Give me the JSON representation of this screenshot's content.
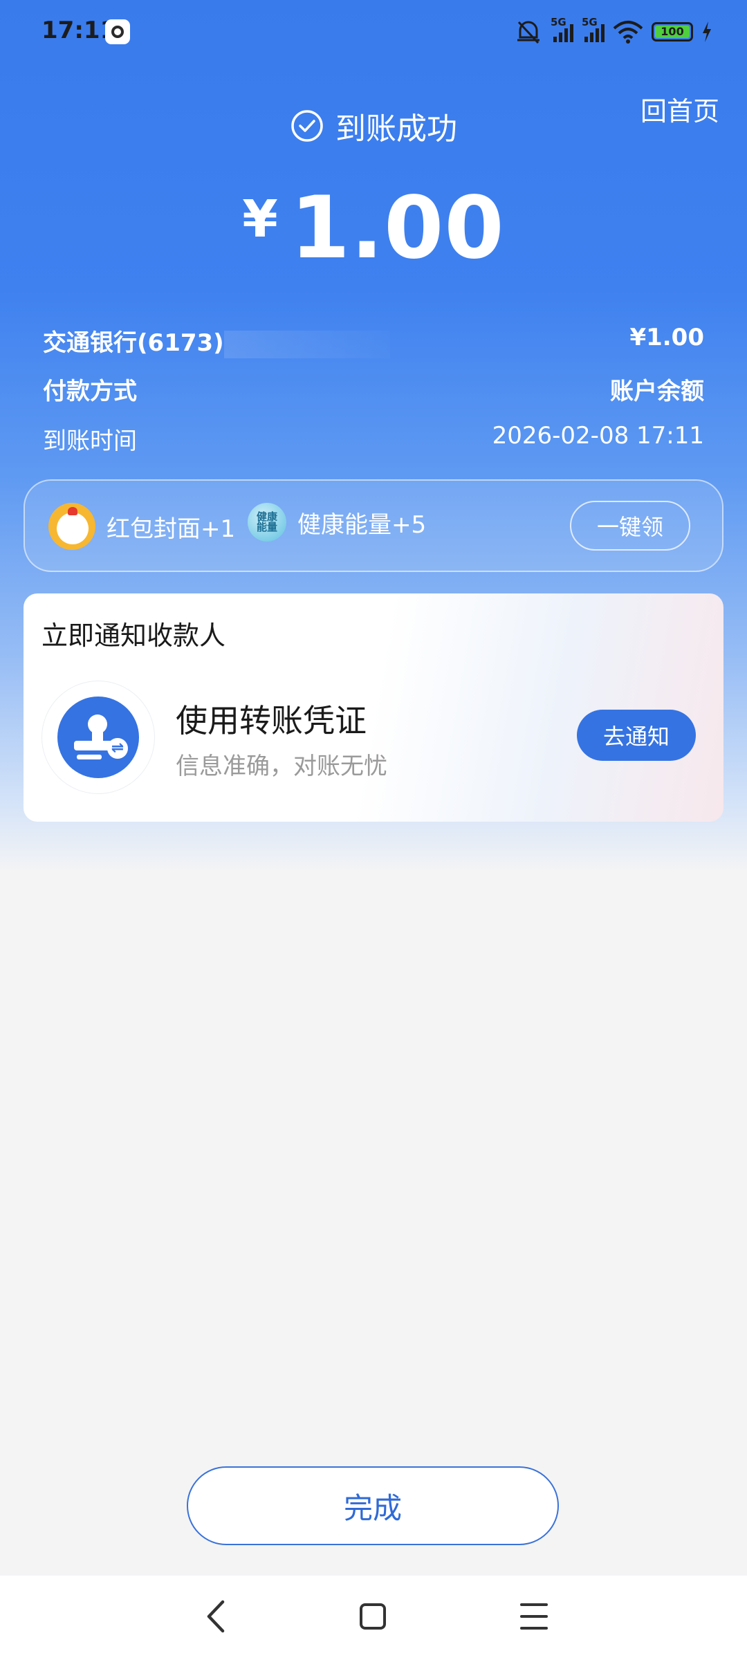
{
  "status_bar": {
    "time": "17:11",
    "network_1": "5G",
    "network_2": "5G",
    "battery": "100",
    "icons": [
      "app-notification-icon",
      "mute-icon",
      "signal-icon",
      "signal-icon",
      "wifi-icon",
      "battery-icon",
      "charging-icon"
    ]
  },
  "header": {
    "home_link": "回首页",
    "status_text": "到账成功",
    "currency": "¥",
    "amount": "1.00"
  },
  "details": {
    "bank_account": "交通银行(6173)",
    "bank_amount": "¥1.00",
    "payment_method_label": "付款方式",
    "payment_method_value": "账户余额",
    "arrival_time_label": "到账时间",
    "arrival_time_value": "2026-02-08 17:11"
  },
  "rewards": {
    "items": [
      {
        "label": "红包封面+1",
        "icon": "chick-avatar-icon"
      },
      {
        "label": "健康能量+5",
        "icon": "health-energy-icon",
        "icon_text": "健康能量"
      }
    ],
    "claim_button": "一键领"
  },
  "notify": {
    "title": "立即通知收款人",
    "main_text": "使用转账凭证",
    "sub_text": "信息准确，对账无忧",
    "button": "去通知"
  },
  "footer": {
    "done_button": "完成"
  },
  "colors": {
    "primary_blue": "#3573e2",
    "header_blue": "#3a7bec",
    "background": "#f4f4f5"
  }
}
